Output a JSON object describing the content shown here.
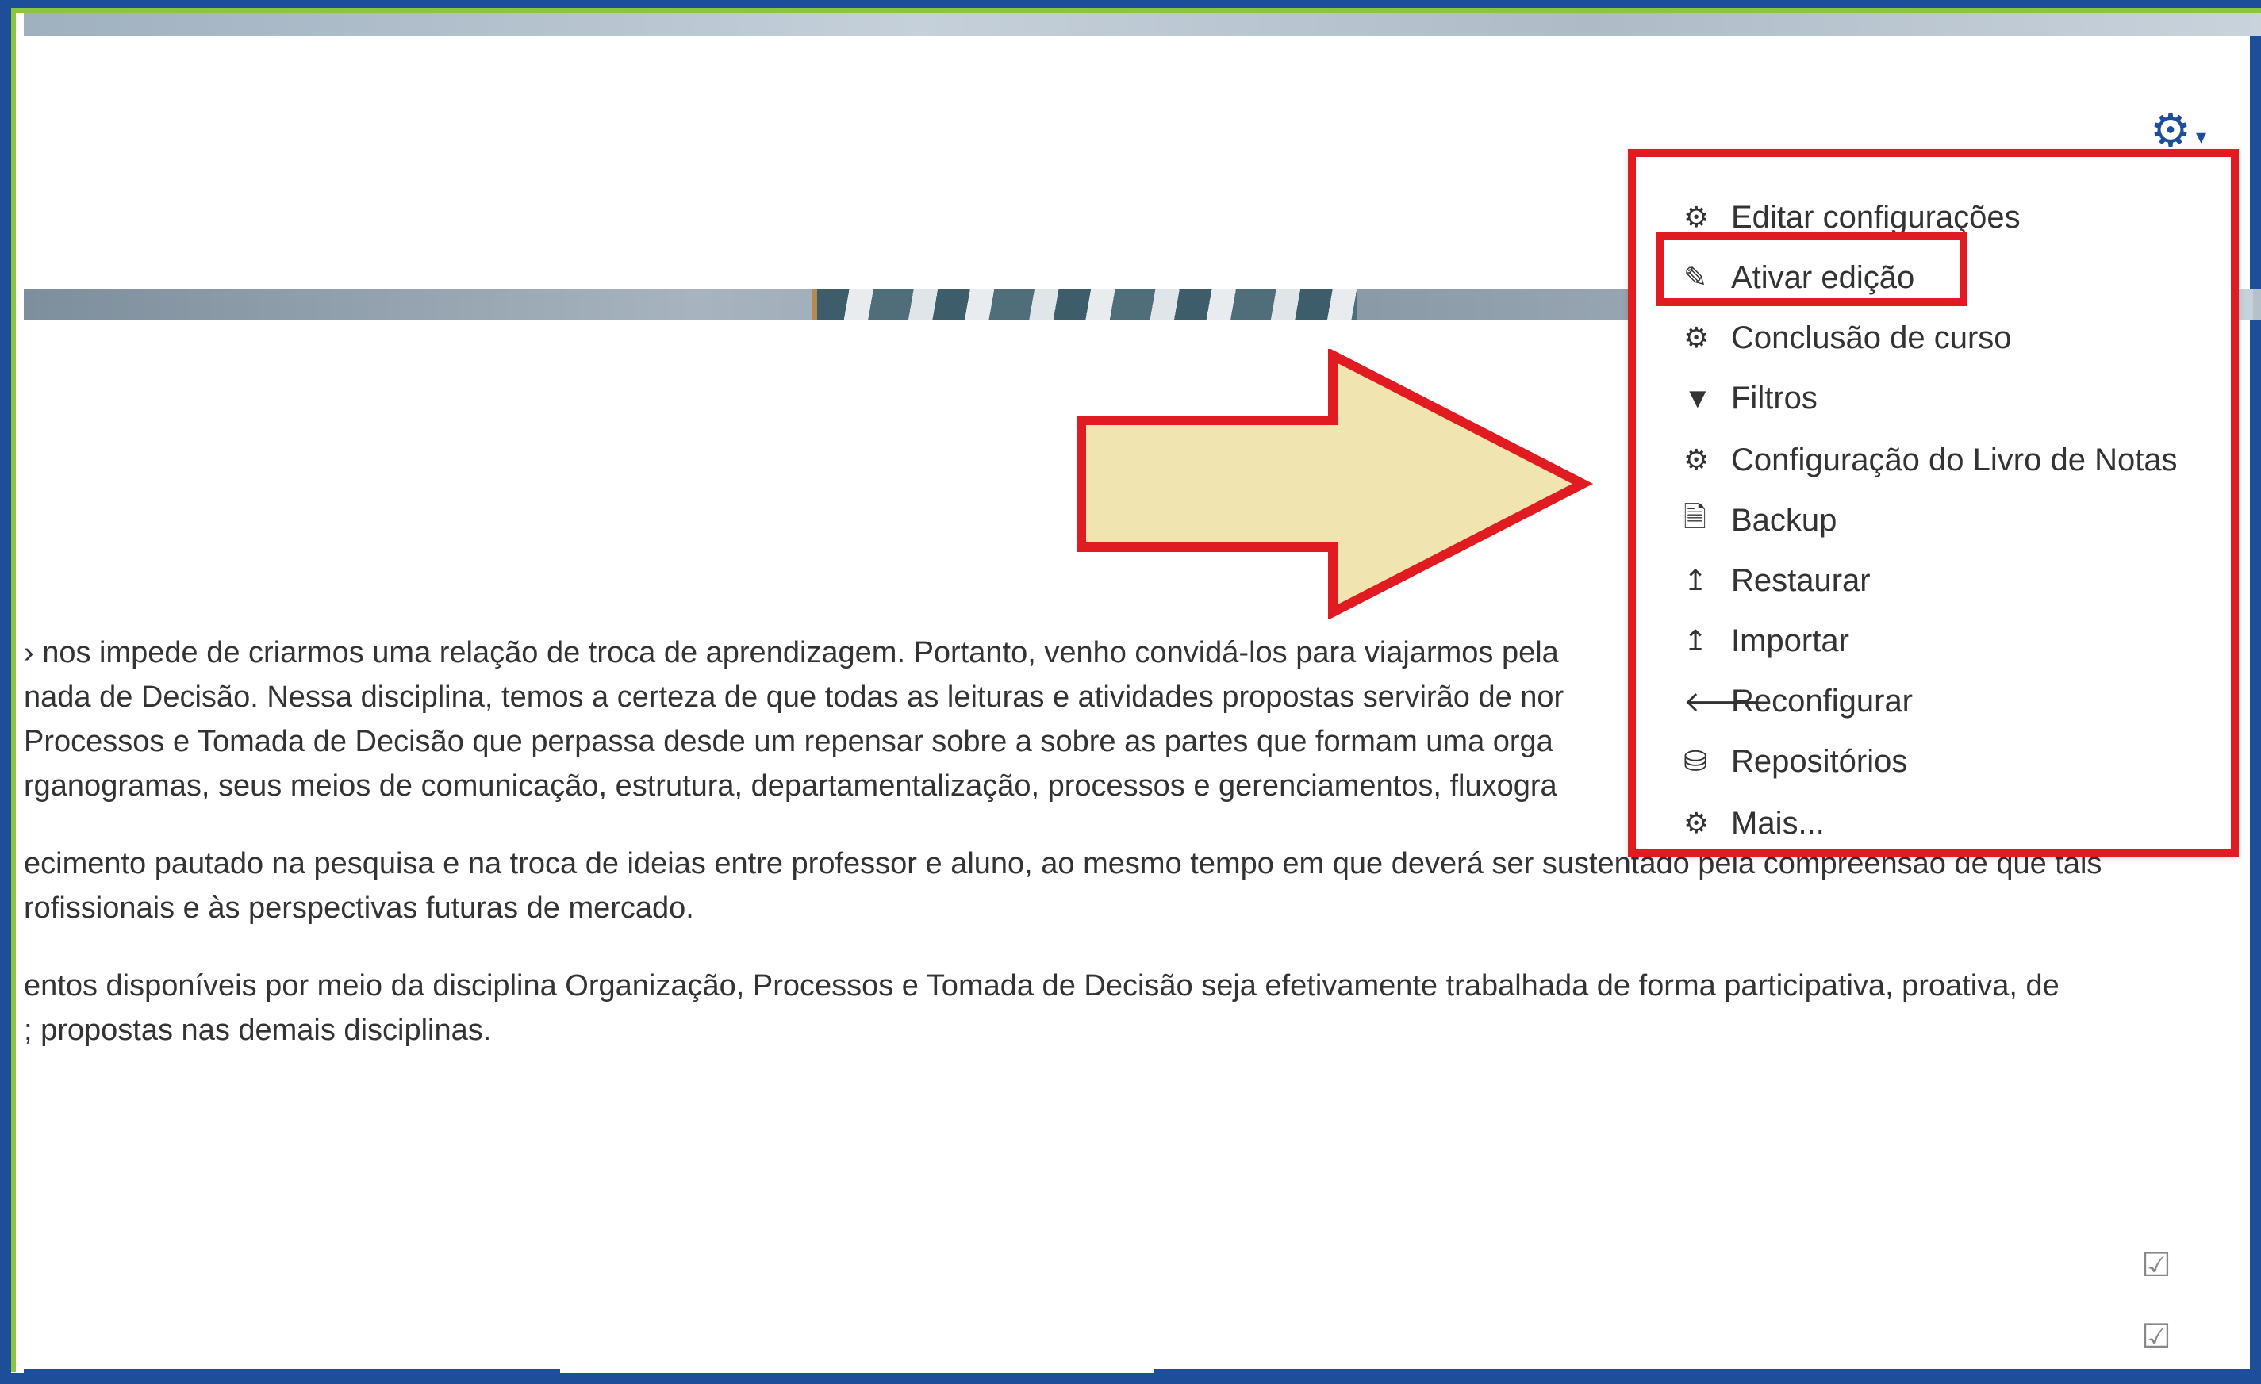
{
  "header": {
    "settings_icon": "gear-icon",
    "settings_caret": "▾"
  },
  "content": {
    "lines": [
      "› nos impede de criarmos uma relação de troca de aprendizagem. Portanto, venho convidá-los para viajarmos pela",
      "nada de Decisão. Nessa disciplina, temos a certeza de que todas as leituras e atividades propostas servirão de nor",
      " Processos e Tomada de Decisão que perpassa desde um repensar sobre a sobre as partes que formam uma orga",
      "rganogramas, seus meios de comunicação, estrutura, departamentalização, processos e gerenciamentos, fluxogra",
      "ecimento pautado na pesquisa e na troca de ideias entre professor e aluno, ao mesmo tempo em que deverá ser sustentado pela compreensão de que tais",
      "rofissionais e às perspectivas futuras de mercado.",
      "entos disponíveis por meio da disciplina Organização, Processos e Tomada de Decisão seja efetivamente trabalhada de forma participativa, proativa, de",
      "; propostas nas demais disciplinas."
    ]
  },
  "menu": {
    "items": [
      {
        "label": "Editar configurações",
        "icon": "gear-icon"
      },
      {
        "label": "Ativar edição",
        "icon": "pencil-icon"
      },
      {
        "label": "Conclusão de curso",
        "icon": "gear-icon"
      },
      {
        "label": "Filtros",
        "icon": "filter-icon"
      },
      {
        "label": "Configuração do Livro de Notas",
        "icon": "gear-icon"
      },
      {
        "label": "Backup",
        "icon": "file-archive-icon"
      },
      {
        "label": "Restaurar",
        "icon": "upload-icon"
      },
      {
        "label": "Importar",
        "icon": "upload-icon"
      },
      {
        "label": "Reconfigurar",
        "icon": "arrow-left-icon"
      },
      {
        "label": "Repositórios",
        "icon": "drive-icon"
      },
      {
        "label": "Mais...",
        "icon": "gear-icon"
      }
    ]
  },
  "annotations": {
    "arrow_color": "#f0e4b0",
    "outline_color": "#e11b22"
  }
}
